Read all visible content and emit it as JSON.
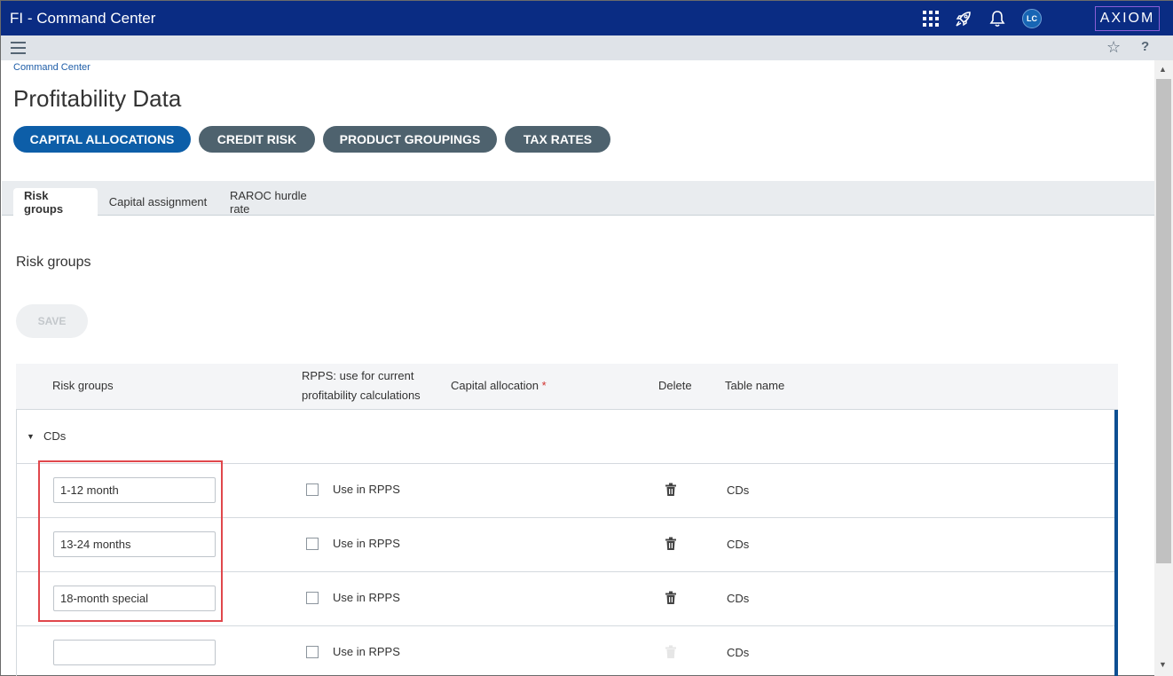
{
  "app": {
    "title": "FI - Command Center",
    "logo": "AXIOM",
    "avatar_initials": "LC",
    "icons": [
      "apps-grid-icon",
      "rocket-icon",
      "bell-icon"
    ]
  },
  "subbar": {
    "menu_icon": "hamburger-icon",
    "favorite_icon": "star-icon",
    "help_label": "?"
  },
  "breadcrumb": "Command Center",
  "page_title": "Profitability Data",
  "nav_pills": [
    {
      "label": "CAPITAL ALLOCATIONS",
      "active": true
    },
    {
      "label": "CREDIT RISK",
      "active": false
    },
    {
      "label": "PRODUCT GROUPINGS",
      "active": false
    },
    {
      "label": "TAX RATES",
      "active": false
    }
  ],
  "tabs": [
    {
      "label": "Risk groups",
      "active": true
    },
    {
      "label": "Capital assignment",
      "active": false
    },
    {
      "label": "RAROC hurdle rate",
      "active": false
    }
  ],
  "section_title": "Risk groups",
  "save_label": "SAVE",
  "grid": {
    "headers": {
      "risk_groups": "Risk groups",
      "rpps_line1": "RPPS: use for current",
      "rpps_line2": "profitability calculations",
      "capital_allocation": "Capital allocation",
      "required_marker": "*",
      "delete": "Delete",
      "table_name": "Table name"
    },
    "group_label": "CDs",
    "rows": [
      {
        "name": "1-12 month",
        "rpps_label": "Use in RPPS",
        "checked": false,
        "table_name": "CDs",
        "delete_enabled": true
      },
      {
        "name": "13-24 months",
        "rpps_label": "Use in RPPS",
        "checked": false,
        "table_name": "CDs",
        "delete_enabled": true
      },
      {
        "name": "18-month special",
        "rpps_label": "Use in RPPS",
        "checked": false,
        "table_name": "CDs",
        "delete_enabled": true
      },
      {
        "name": "",
        "rpps_label": "Use in RPPS",
        "checked": false,
        "table_name": "CDs",
        "delete_enabled": false
      }
    ]
  },
  "colors": {
    "topbar": "#0a2c83",
    "pill_active": "#0d5ea8",
    "pill_inactive": "#4e626e",
    "highlight": "#e0474c"
  }
}
